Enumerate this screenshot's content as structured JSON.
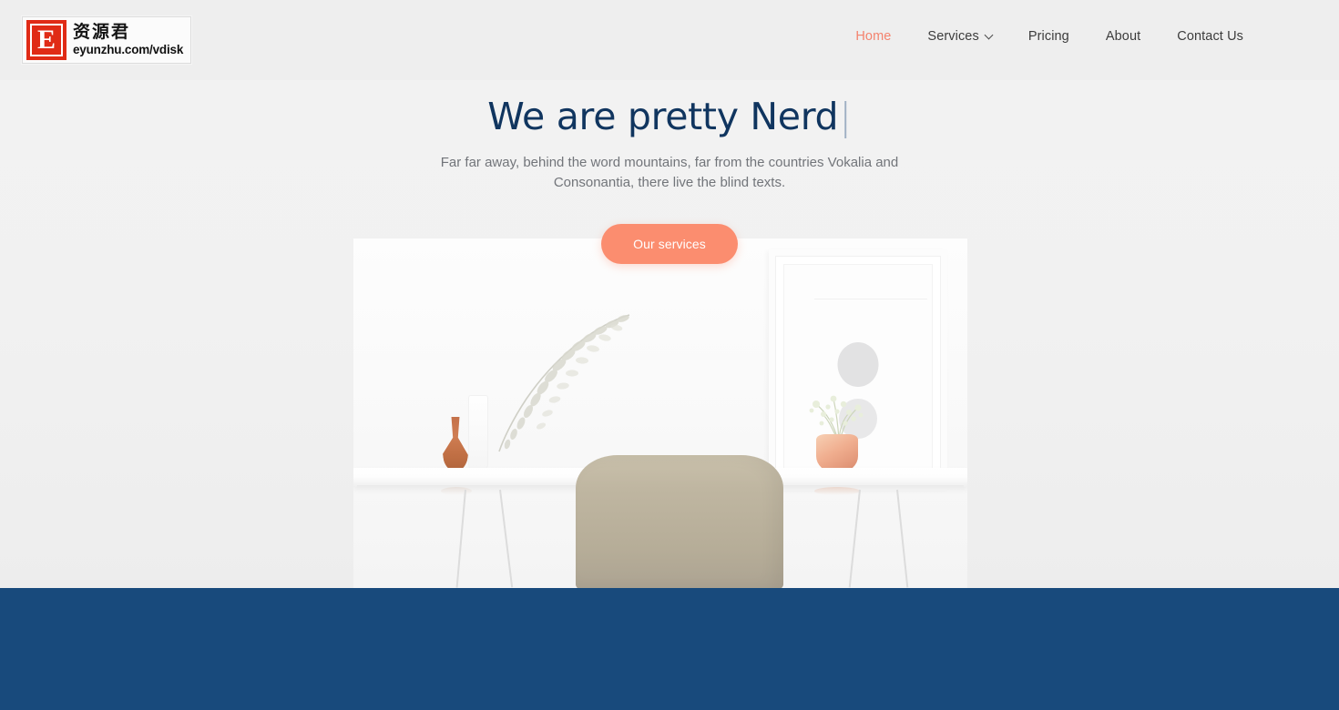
{
  "header": {
    "logo": {
      "mark_letter": "E",
      "chinese_name": "资源君",
      "url_text": "eyunzhu.com/vdisk",
      "mark_color": "#e02b16"
    },
    "nav": {
      "items": [
        {
          "label": "Home",
          "active": true,
          "has_dropdown": false
        },
        {
          "label": "Services",
          "active": false,
          "has_dropdown": true
        },
        {
          "label": "Pricing",
          "active": false,
          "has_dropdown": false
        },
        {
          "label": "About",
          "active": false,
          "has_dropdown": false
        },
        {
          "label": "Contact Us",
          "active": false,
          "has_dropdown": false
        }
      ],
      "active_color": "#f4836e",
      "idle_color": "#3c3c3c"
    }
  },
  "hero": {
    "title_text": "We are pretty Nerd",
    "typing_cursor": "|",
    "title_color": "#10355f",
    "subtitle_line1": "Far far away, behind the word mountains, far from the countries Vokalia and Consonantia,",
    "subtitle_line2": "there live the blind texts.",
    "subtitle_full": "Far far away, behind the word mountains, far from the countries Vokalia and Consonantia, there live the blind texts.",
    "cta_label": "Our services",
    "cta_color": "#fb8d6f",
    "background_color": "#f1f1f1"
  },
  "illustration": {
    "name": "white-desk-workspace-photo",
    "elements": [
      "picture-frame",
      "desk",
      "chair",
      "wooden-vase",
      "glass-vase-with-dried-branch",
      "copper-pot-with-plant"
    ]
  },
  "footer_section": {
    "background_color": "#184a7c"
  }
}
